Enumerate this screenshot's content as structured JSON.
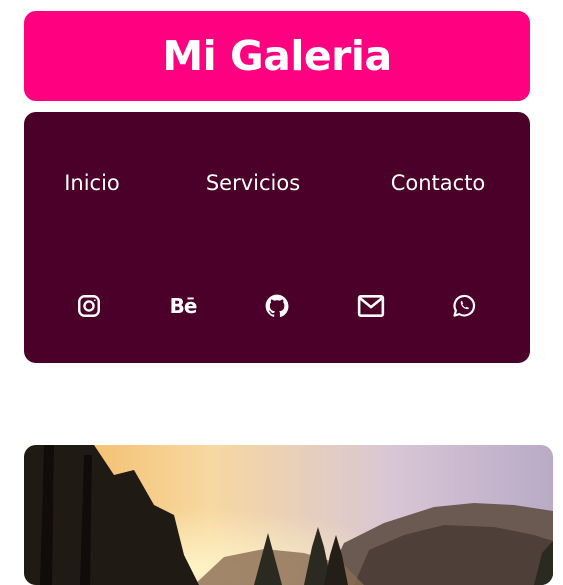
{
  "colors": {
    "accent": "#ff0080",
    "panel": "#4a0028"
  },
  "header": {
    "title": "Mi Galeria"
  },
  "nav": {
    "links": [
      {
        "label": "Inicio"
      },
      {
        "label": "Servicios"
      },
      {
        "label": "Contacto"
      }
    ]
  },
  "socials": [
    {
      "icon": "instagram-icon"
    },
    {
      "icon": "behance-icon",
      "glyph": "Bē"
    },
    {
      "icon": "github-icon"
    },
    {
      "icon": "mail-icon"
    },
    {
      "icon": "whatsapp-icon"
    }
  ],
  "gallery": {
    "first_image": "landscape-sunset-photo"
  }
}
